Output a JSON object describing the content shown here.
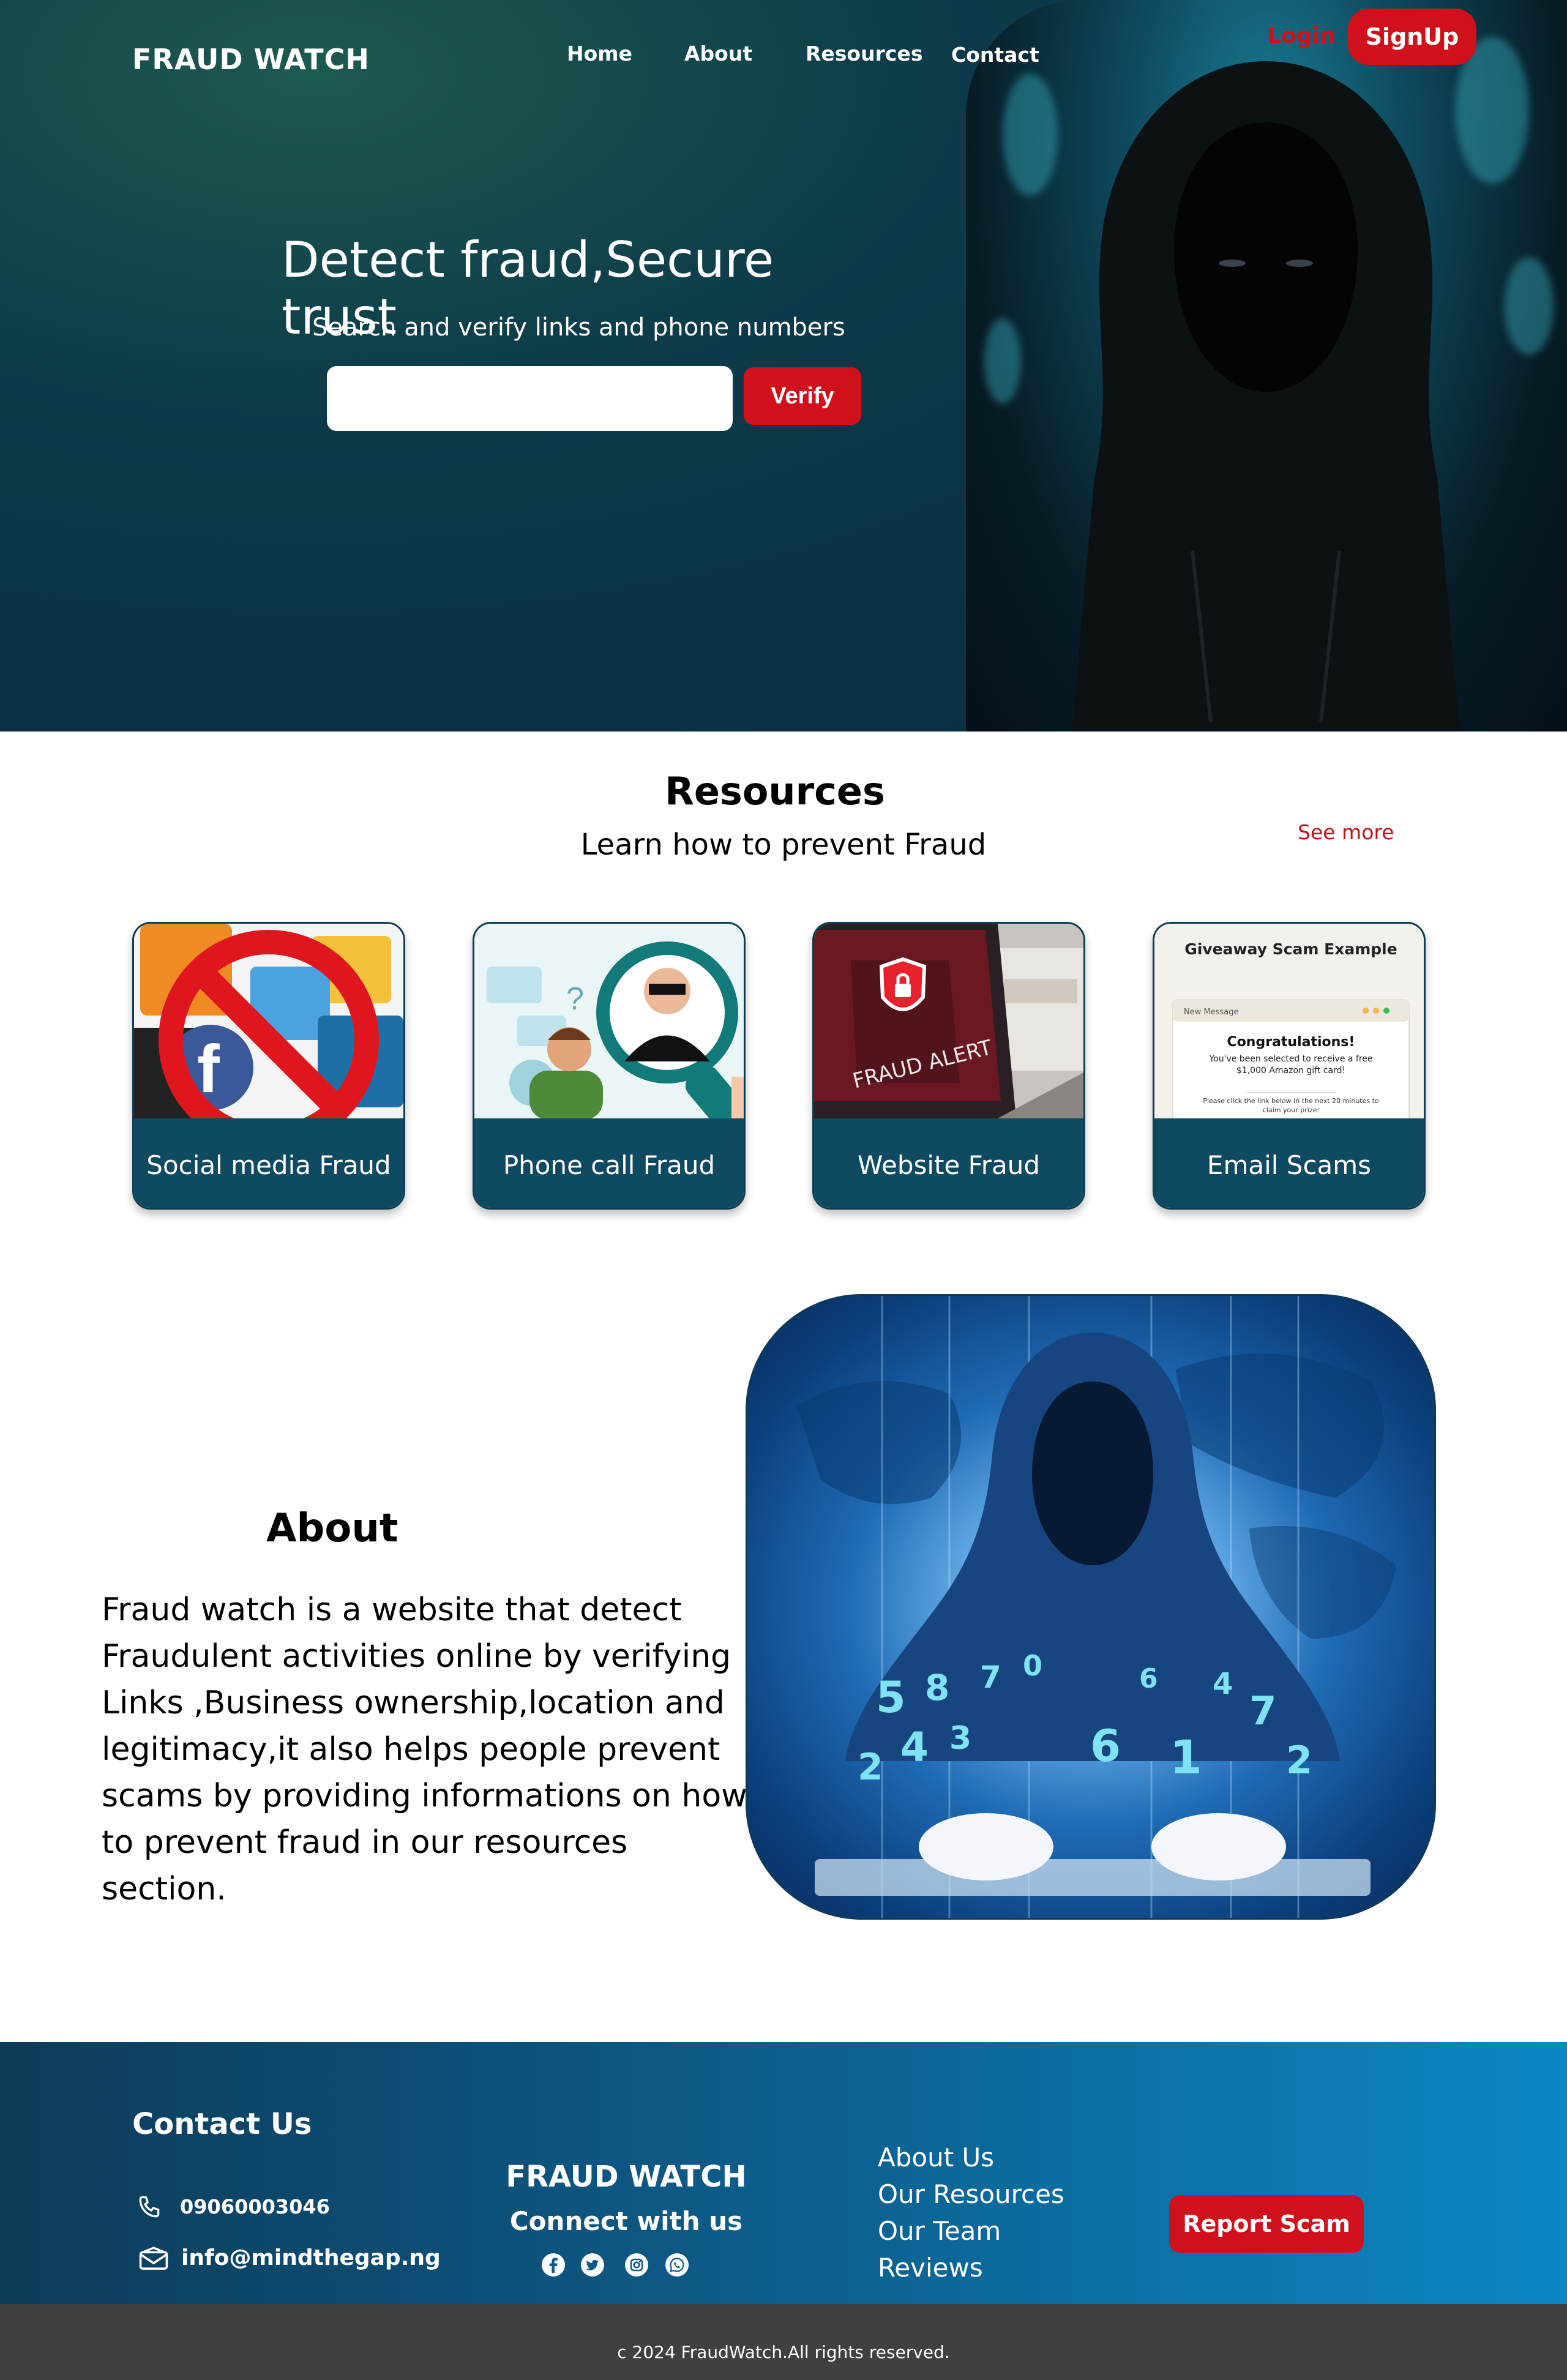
{
  "brand": "FRAUD WATCH",
  "nav": {
    "home": "Home",
    "about": "About",
    "resources": "Resources",
    "contact": "Contact"
  },
  "auth": {
    "login": "Login",
    "signup": "SignUp"
  },
  "hero": {
    "title": "Detect fraud,Secure trust",
    "subtitle": "Search and verify links and phone numbers",
    "search_value": "",
    "verify_label": "Verify"
  },
  "resources": {
    "title": "Resources",
    "subtitle": "Learn how to prevent Fraud",
    "see_more": "See more",
    "cards": [
      {
        "label": "Social media Fraud"
      },
      {
        "label": "Phone call Fraud",
        "image_text": "?"
      },
      {
        "label": "Website Fraud",
        "image_text": "FRAUD ALERT"
      },
      {
        "label": "Email Scams",
        "image_title": "Giveaway Scam Example",
        "image_window": "New Message",
        "image_heading": "Congratulations!",
        "image_body": "You've been selected to receive a free $1,000 Amazon gift card!",
        "image_footer": "Please click the link below in the next 20 minutes to claim your prize:"
      }
    ]
  },
  "about": {
    "title": "About",
    "lines": [
      "Fraud watch is a website that detect",
      "Fraudulent activities online by verifying",
      "Links ,Business ownership,location and",
      "legitimacy,it also helps people prevent",
      "scams by providing informations on how",
      "to prevent fraud in our resources section."
    ],
    "image_digits": [
      "5",
      "8",
      "7",
      "0",
      "4",
      "3",
      "2",
      "6",
      "1",
      "7",
      "4",
      "2",
      "6"
    ]
  },
  "footer": {
    "contact_title": "Contact Us",
    "phone": "09060003046",
    "email": "info@mindthegap.ng",
    "brand": "FRAUD WATCH",
    "connect": "Connect with us",
    "links": [
      "About Us",
      "Our Resources",
      "Our Team",
      "Reviews"
    ],
    "report_label": "Report Scam",
    "copyright": "c 2024 FraudWatch.All rights reserved."
  },
  "colors": {
    "accent": "#d0111b",
    "dark_teal": "#0e4a62",
    "footer_start": "#0d3b58",
    "footer_end": "#0b87c4",
    "copyright_bg": "#404040"
  },
  "icons": [
    "phone-icon",
    "mail-icon",
    "facebook-icon",
    "twitter-icon",
    "instagram-icon",
    "whatsapp-icon"
  ]
}
